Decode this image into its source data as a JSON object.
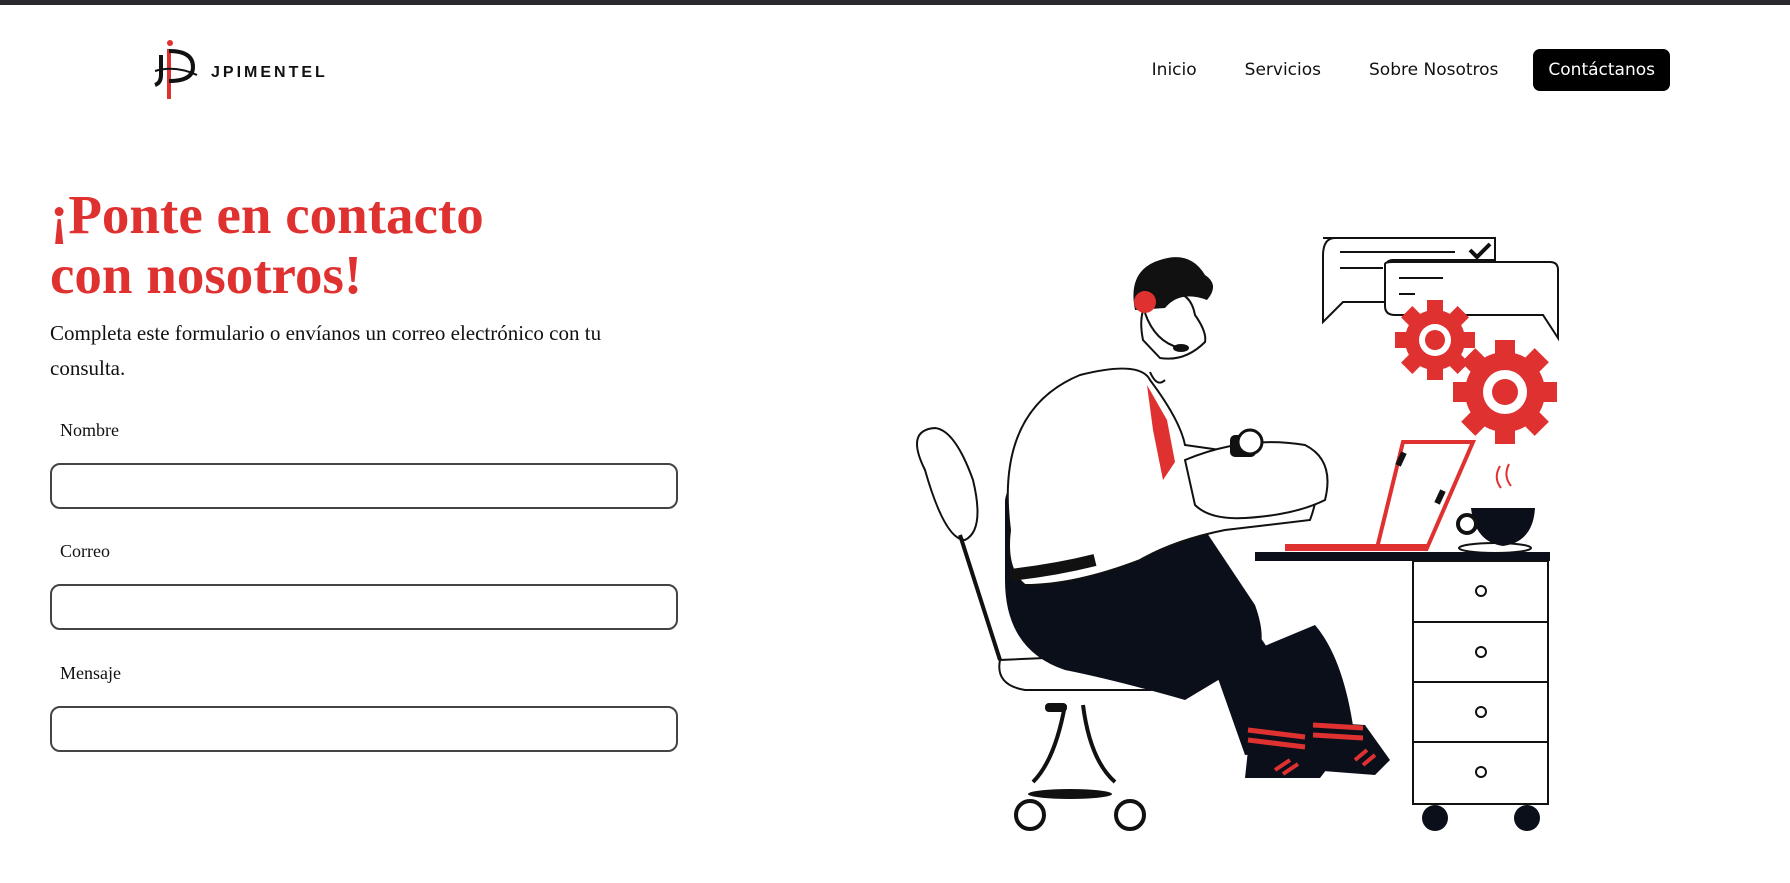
{
  "brand": {
    "name": "JPIMENTEL"
  },
  "nav": {
    "items": [
      {
        "label": "Inicio"
      },
      {
        "label": "Servicios"
      },
      {
        "label": "Sobre Nosotros"
      }
    ],
    "cta": "Contáctanos"
  },
  "hero": {
    "title_line1": "¡Ponte en contacto",
    "title_line2": "con nosotros!",
    "subtitle": "Completa este formulario o envíanos un correo electrónico con tu consulta."
  },
  "form": {
    "fields": [
      {
        "label": "Nombre",
        "value": ""
      },
      {
        "label": "Correo",
        "value": ""
      },
      {
        "label": "Mensaje",
        "value": ""
      }
    ]
  },
  "colors": {
    "accent": "#e03131",
    "dark": "#0b0f1a",
    "button": "#000000"
  },
  "icons": [
    "logo-icon",
    "support-agent-illustration"
  ]
}
